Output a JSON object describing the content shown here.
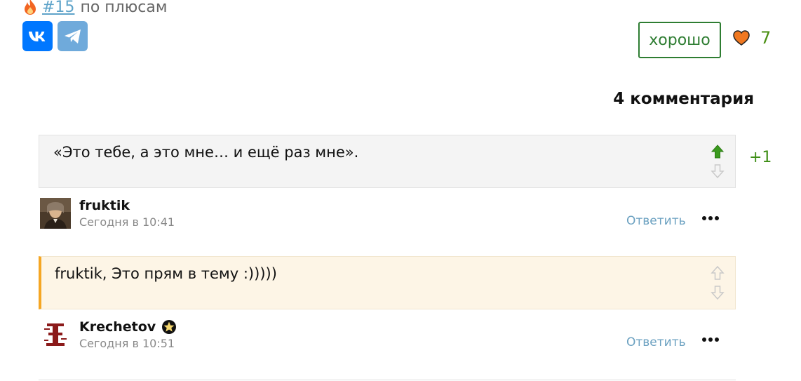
{
  "rank": {
    "link_text": "#15",
    "suffix": "по плюсам",
    "icon": "flame-icon"
  },
  "share": {
    "vk_label": "VK",
    "tg_icon": "telegram-icon"
  },
  "rating": {
    "button_label": "хорошо",
    "likes": "7",
    "heart_color": "#f07820"
  },
  "comments_header": "4 комментария",
  "comments": [
    {
      "text": "«Это тебе, а это мне… и ещё раз мне».",
      "author": "fruktik",
      "date": "Сегодня в 10:41",
      "reply": "Ответить",
      "score": "+1",
      "upvoted": true
    },
    {
      "text": "fruktik, Это прям в тему :)))))",
      "author": "Krechetov",
      "date": "Сегодня в 10:51",
      "reply": "Ответить",
      "badge_icon": "star-badge-icon",
      "accent": "#f5a623"
    }
  ],
  "colors": {
    "green": "#2e7d32",
    "link": "#6aa0c0",
    "vk": "#0077ff",
    "telegram": "#6faadb"
  }
}
